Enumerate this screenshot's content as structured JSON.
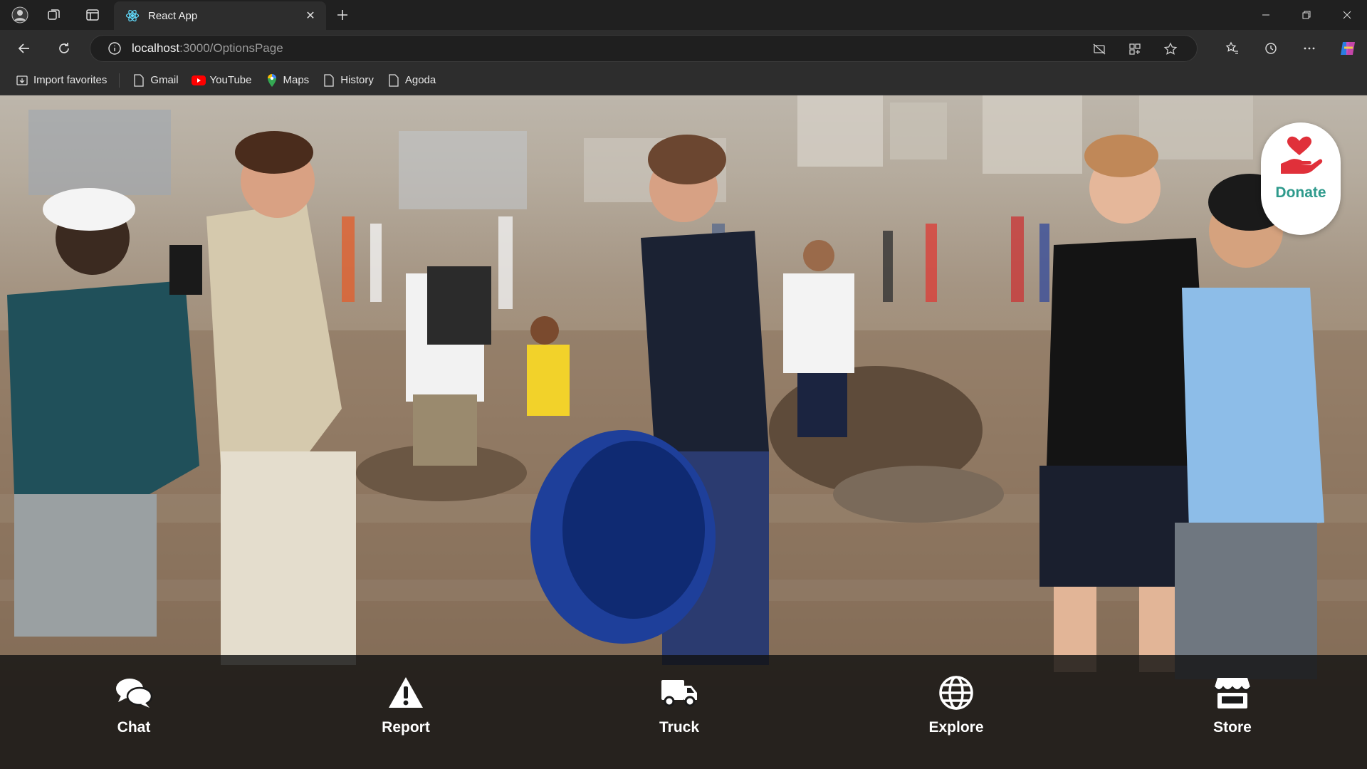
{
  "browser": {
    "tab_title": "React App",
    "url_host": "localhost",
    "url_path": ":3000/OptionsPage",
    "bookmarks": [
      {
        "label": "Import favorites",
        "icon": "import-icon"
      },
      {
        "label": "Gmail",
        "icon": "page-icon"
      },
      {
        "label": "YouTube",
        "icon": "youtube-icon"
      },
      {
        "label": "Maps",
        "icon": "maps-icon"
      },
      {
        "label": "History",
        "icon": "page-icon"
      },
      {
        "label": "Agoda",
        "icon": "page-icon"
      }
    ]
  },
  "page": {
    "donate_label": "Donate",
    "nav": [
      {
        "label": "Chat",
        "icon": "chat-icon"
      },
      {
        "label": "Report",
        "icon": "warning-icon"
      },
      {
        "label": "Truck",
        "icon": "truck-icon"
      },
      {
        "label": "Explore",
        "icon": "globe-icon"
      },
      {
        "label": "Store",
        "icon": "store-icon"
      }
    ]
  },
  "colors": {
    "donate_accent": "#2e9a8c",
    "heart": "#e0303a",
    "nav_bg": "#121212"
  }
}
